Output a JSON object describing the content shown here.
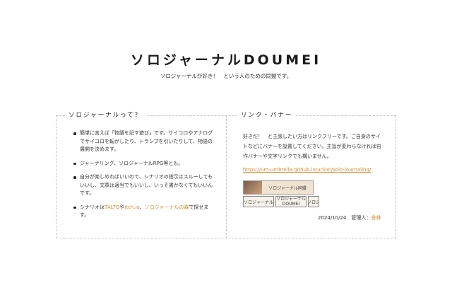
{
  "header": {
    "title": "ソロジャーナルDOUMEI",
    "subtitle": "ソロジャーナルが好き！　という人のための同盟です。"
  },
  "about": {
    "heading": "ソロジャーナルって？",
    "items": [
      {
        "text": "簡単に言えば「物語を記す遊び」です。サイコロやアナログでサイコロを転がしたり、トランプを引いたりして、物語の展開を決めます。"
      },
      {
        "text": "ジャーナリング、ソロジャーナルRPG等とも。"
      },
      {
        "text": "自分が楽しめればいいので、シナリオの指示はスルーしてもいいし、文章は適当でもいいし、いっそ書かなくてもいいんです。"
      },
      {
        "prefix": "シナリオは",
        "link1": "TALTO",
        "sep1": "や",
        "link2": "itch.io",
        "sep2": "、",
        "link3": "ソロジャーナルの森",
        "suffix": "で探せます。"
      }
    ]
  },
  "links": {
    "heading": "リンク・バナー",
    "text": "好きだ！　と主張したい方はリンクフリーです。ご自身のサイトなどにバナーを設置してください。主旨が変わらなければ自作バナーや文字リンクでも構いません。",
    "url": "https://um-umbrella.github.io/union/solo-journaling/",
    "banners": {
      "large": "ソロジャーナル同盟",
      "medium": "ソロジャーナル",
      "small_line1": "ソロジャーナル",
      "small_line2": "DOUMEI",
      "tiny": "ソロジ"
    }
  },
  "footer": {
    "date": "2024/10/24",
    "admin_label": "管理人：",
    "admin_name": "舎林"
  }
}
